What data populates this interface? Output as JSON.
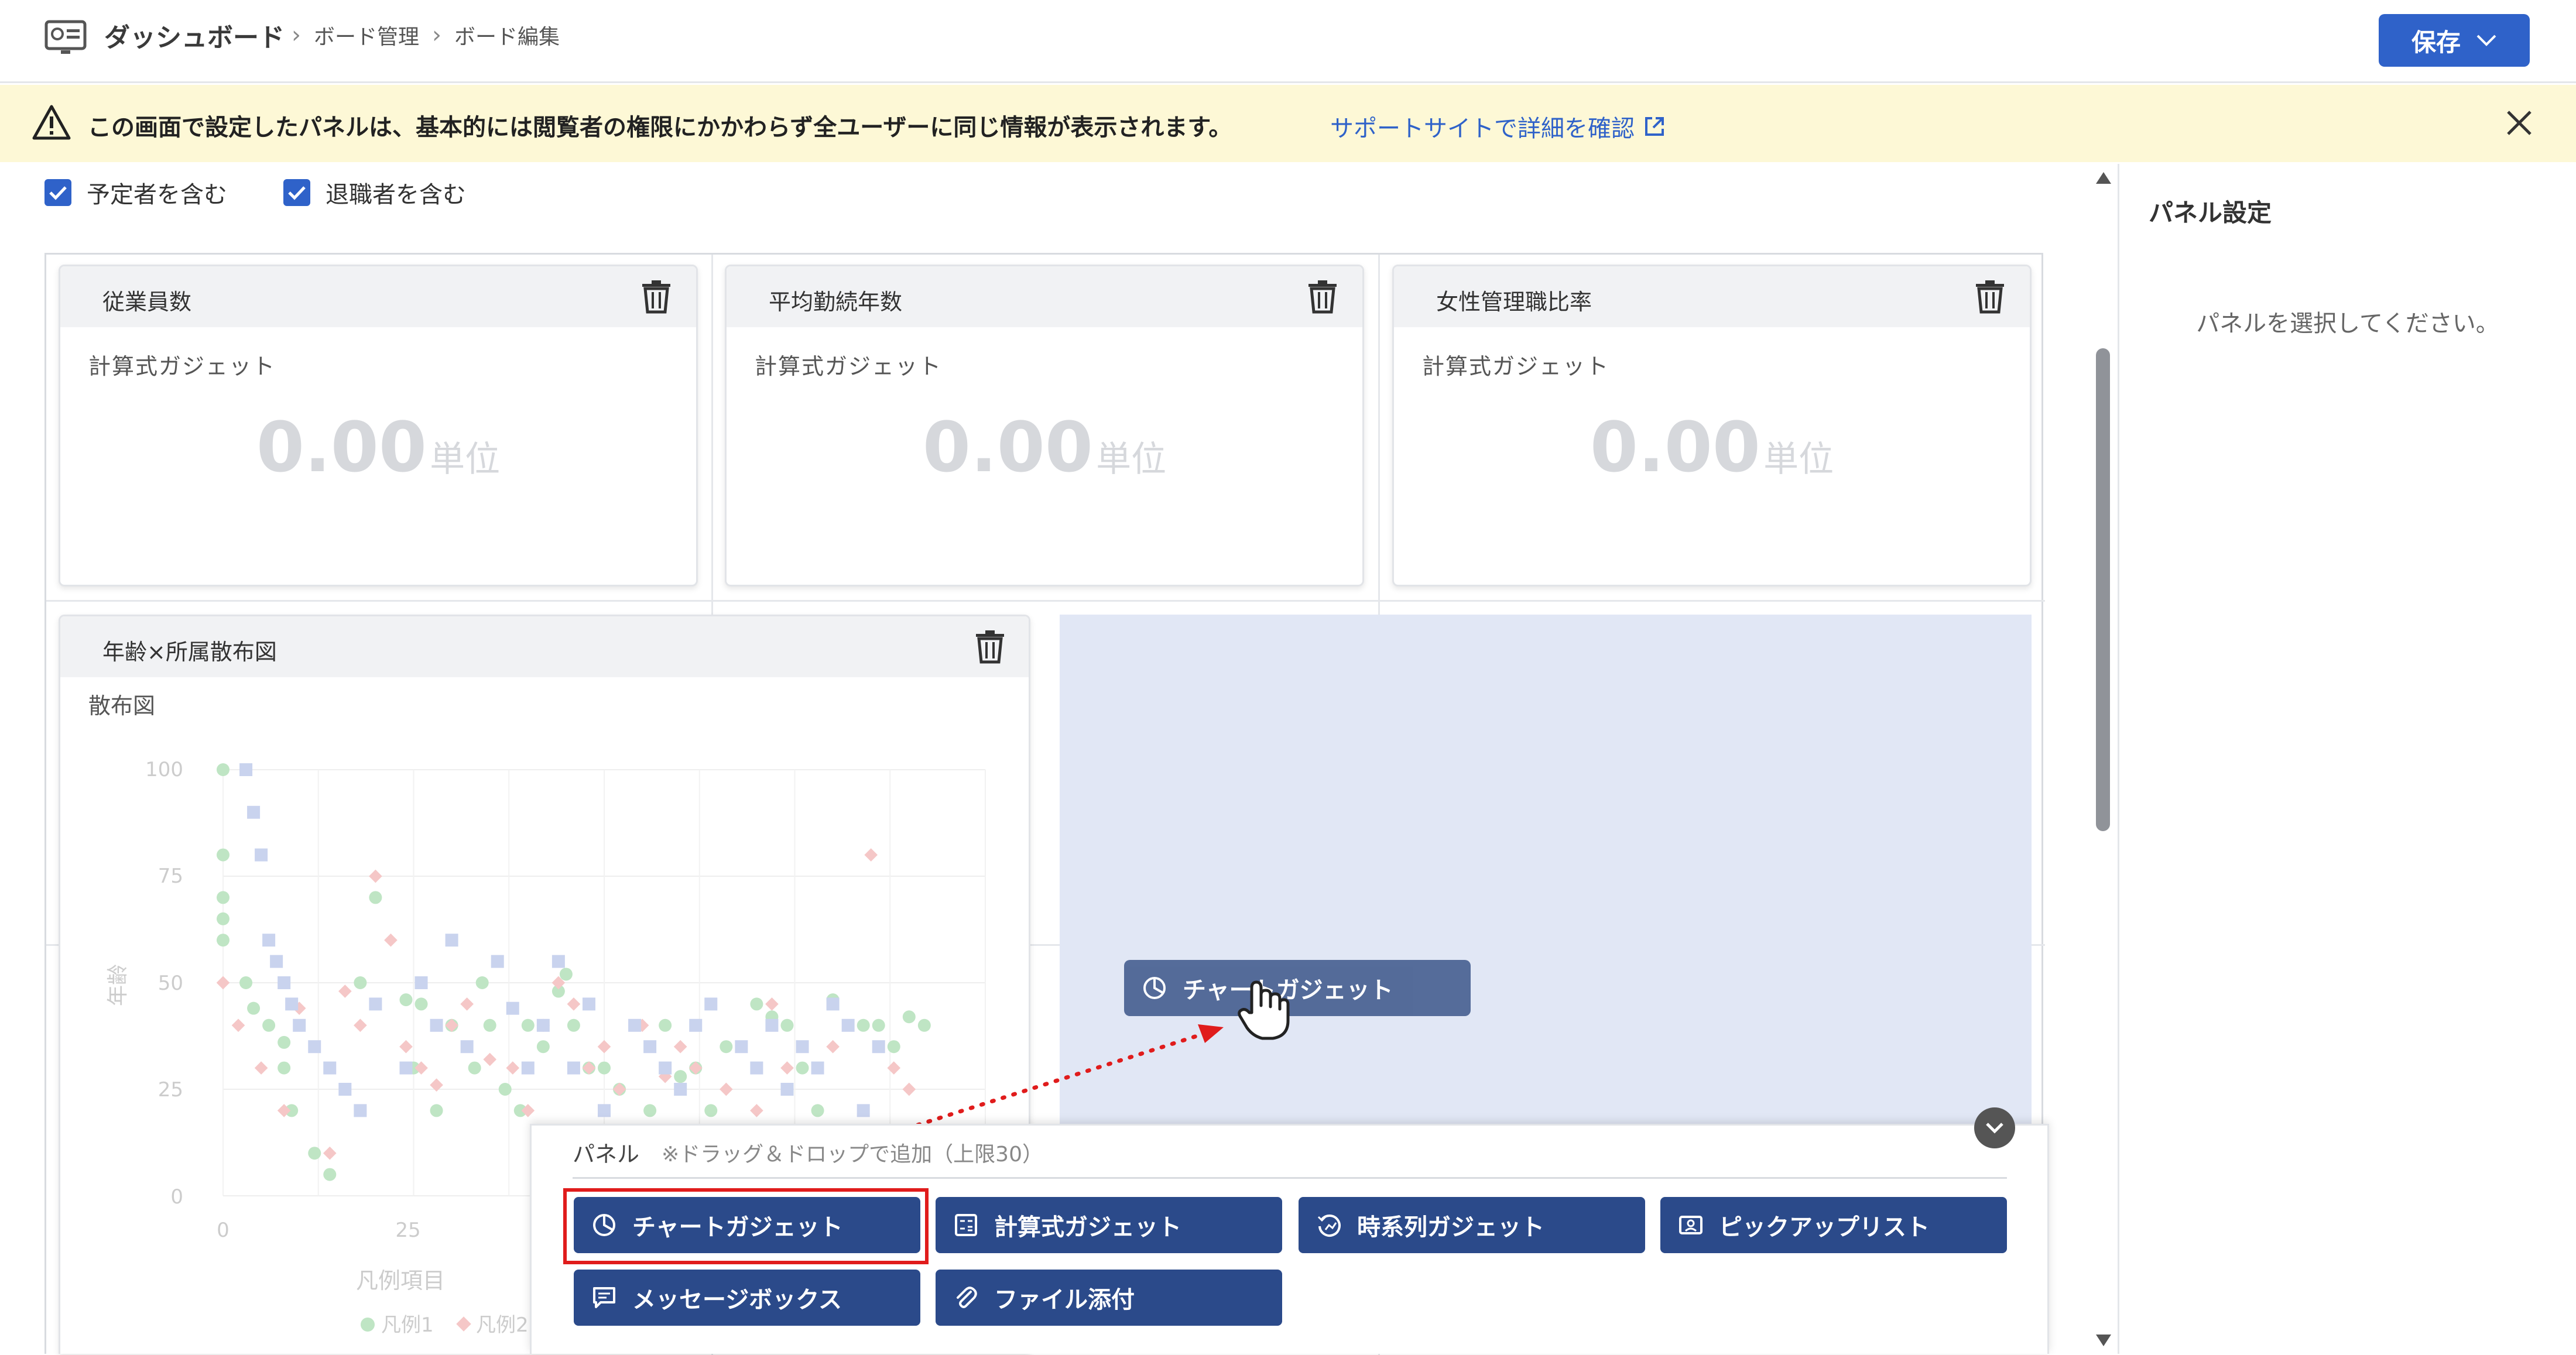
{
  "header": {
    "title": "ダッシュボード",
    "breadcrumbs": [
      "ボード管理",
      "ボード編集"
    ],
    "save_label": "保存"
  },
  "banner": {
    "message": "この画面で設定したパネルは、基本的には閲覧者の権限にかかわらず全ユーザーに同じ情報が表示されます。",
    "link": "サポートサイトで詳細を確認"
  },
  "filters": {
    "include_planned": "予定者を含む",
    "include_retired": "退職者を含む"
  },
  "panels": [
    {
      "title": "従業員数",
      "type": "計算式ガジェット",
      "value": "0.00",
      "unit": "単位"
    },
    {
      "title": "平均勤続年数",
      "type": "計算式ガジェット",
      "value": "0.00",
      "unit": "単位"
    },
    {
      "title": "女性管理職比率",
      "type": "計算式ガジェット",
      "value": "0.00",
      "unit": "単位"
    }
  ],
  "scatter_panel": {
    "title": "年齢×所属散布図",
    "type": "散布図",
    "ylabel": "年齢",
    "yticks": [
      "100",
      "75",
      "50",
      "25",
      "0"
    ],
    "xticks": [
      "0",
      "25"
    ],
    "legend_title": "凡例項目",
    "legend_items": [
      "凡例1",
      "凡例2"
    ]
  },
  "chart_data": {
    "type": "scatter",
    "ylim": [
      0,
      100
    ],
    "ylabel": "年齢",
    "series": [
      {
        "name": "凡例1",
        "color": "#bfe5c4",
        "x": [
          0,
          0,
          0,
          0,
          0,
          3,
          4,
          6,
          8,
          8,
          9,
          12,
          14,
          18,
          20,
          24,
          25,
          26,
          28,
          30,
          33,
          34,
          35,
          37,
          39,
          40,
          42,
          44,
          45,
          46,
          48,
          50,
          52,
          56,
          58,
          60,
          62,
          64,
          66,
          70,
          72,
          74,
          76,
          78,
          80,
          84,
          86,
          88,
          90,
          92
        ],
        "y": [
          100,
          80,
          70,
          65,
          60,
          50,
          44,
          40,
          36,
          30,
          20,
          10,
          5,
          50,
          70,
          46,
          30,
          45,
          20,
          40,
          30,
          50,
          40,
          25,
          20,
          40,
          35,
          48,
          52,
          40,
          30,
          30,
          25,
          20,
          40,
          28,
          30,
          20,
          35,
          45,
          42,
          40,
          30,
          20,
          46,
          40,
          40,
          35,
          42,
          40
        ]
      },
      {
        "name": "凡例2",
        "color": "#f5c7c7",
        "x": [
          0,
          2,
          5,
          8,
          10,
          14,
          16,
          18,
          20,
          22,
          24,
          26,
          28,
          30,
          32,
          35,
          38,
          40,
          42,
          44,
          46,
          48,
          50,
          52,
          55,
          58,
          60,
          62,
          66,
          70,
          72,
          74,
          80,
          85,
          88,
          90
        ],
        "y": [
          50,
          40,
          30,
          20,
          44,
          10,
          48,
          40,
          75,
          60,
          35,
          30,
          26,
          40,
          45,
          32,
          30,
          20,
          40,
          50,
          45,
          30,
          35,
          25,
          40,
          28,
          35,
          30,
          25,
          20,
          45,
          30,
          35,
          80,
          30,
          25
        ]
      },
      {
        "name": "",
        "color": "#c9d3ee",
        "x": [
          3,
          4,
          5,
          6,
          7,
          8,
          9,
          10,
          12,
          14,
          16,
          18,
          20,
          24,
          26,
          28,
          30,
          32,
          36,
          38,
          40,
          42,
          44,
          46,
          48,
          50,
          54,
          56,
          58,
          60,
          62,
          64,
          68,
          70,
          72,
          74,
          76,
          78,
          80,
          82,
          84,
          86
        ],
        "y": [
          100,
          90,
          80,
          60,
          55,
          50,
          45,
          40,
          35,
          30,
          25,
          20,
          45,
          30,
          50,
          40,
          60,
          35,
          55,
          44,
          30,
          40,
          55,
          30,
          45,
          20,
          40,
          35,
          30,
          25,
          40,
          45,
          35,
          30,
          40,
          25,
          35,
          30,
          45,
          40,
          20,
          35
        ]
      }
    ]
  },
  "dropzone": {
    "ghost_label": "チャートガジェット"
  },
  "palette": {
    "title": "パネル",
    "hint": "※ドラッグ＆ドロップで追加（上限30）",
    "buttons": [
      "チャートガジェット",
      "計算式ガジェット",
      "時系列ガジェット",
      "ピックアップリスト",
      "メッセージボックス",
      "ファイル添付"
    ]
  },
  "right_panel": {
    "title": "パネル設定",
    "placeholder": "パネルを選択してください。"
  }
}
